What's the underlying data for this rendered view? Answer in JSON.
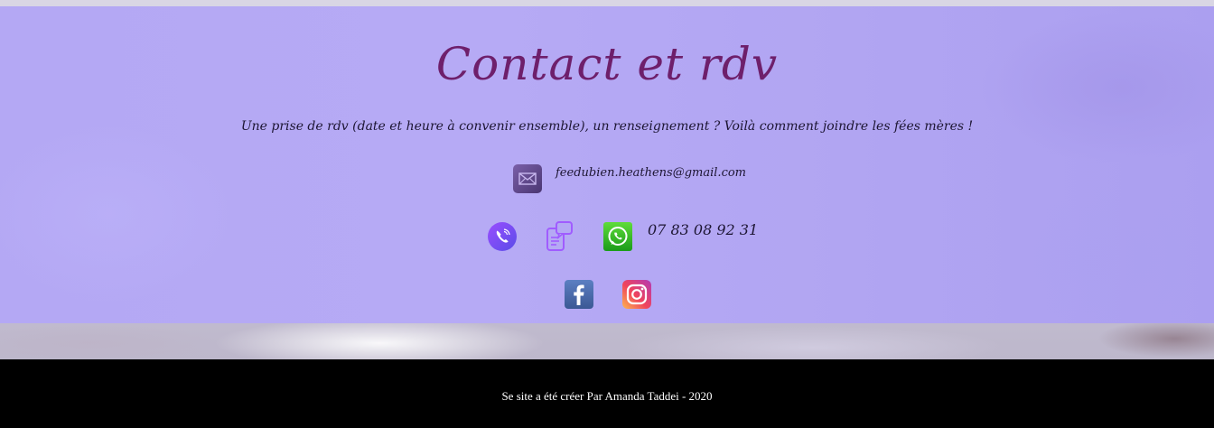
{
  "contact": {
    "title": "Contact et rdv",
    "subtitle": "Une prise de rdv (date et heure à convenir ensemble), un renseignement ? Voilà comment joindre les fées mères !",
    "email": "feedubien.heathens@gmail.com",
    "phone": "07 83 08 92 31"
  },
  "icons": {
    "email": "envelope-icon",
    "phone": "phone-icon",
    "sms": "sms-icon",
    "whatsapp": "whatsapp-icon",
    "facebook": "facebook-icon",
    "instagram": "instagram-icon"
  },
  "colors": {
    "panel": "#b4a8f4",
    "title": "#6e1f6b",
    "footer": "#000000"
  },
  "footer": {
    "text": "Se site a été créer Par Amanda Taddei - 2020"
  }
}
